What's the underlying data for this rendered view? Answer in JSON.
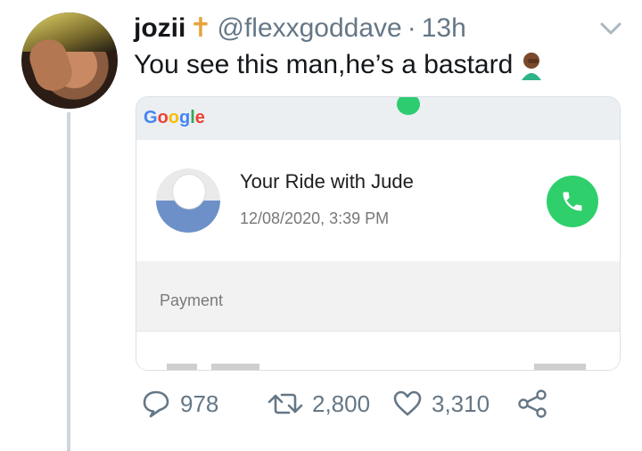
{
  "tweet": {
    "display_name": "jozii",
    "name_emoji": "✝",
    "handle": "@flexxgoddave",
    "separator": "·",
    "time": "13h",
    "text": "You see this man,he’s a bastard",
    "emoji_icon": "facepalm-emoji-icon"
  },
  "embedded_card": {
    "map_brand": {
      "g1": "G",
      "o1": "o",
      "o2": "o",
      "g2": "g",
      "l": "l",
      "e": "e"
    },
    "ride_title": "Your Ride with Jude",
    "ride_time": "12/08/2020, 3:39 PM",
    "payment_label": "Payment"
  },
  "actions": {
    "replies": "978",
    "retweets": "2,800",
    "likes": "3,310"
  },
  "colors": {
    "muted": "#657786",
    "call_button": "#2fcf6c",
    "thread_line": "#ccd6dd"
  }
}
